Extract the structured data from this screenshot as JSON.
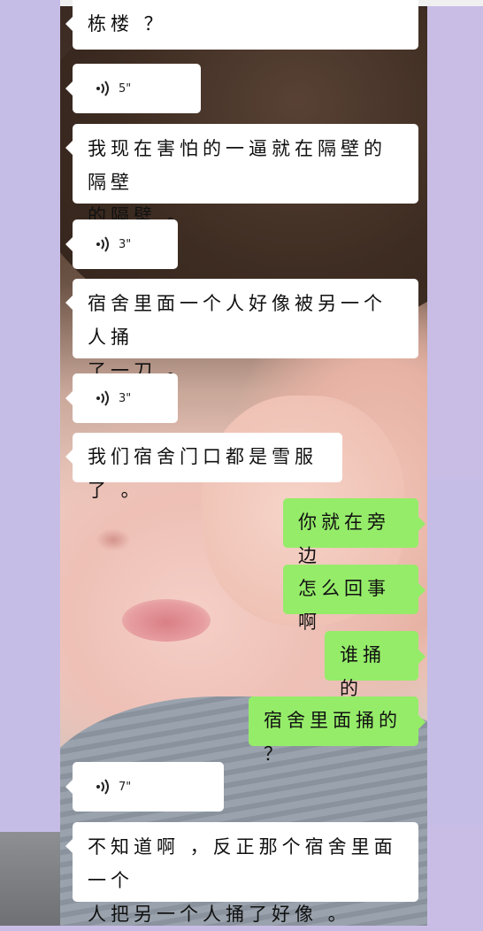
{
  "messages": [
    {
      "type": "text",
      "side": "left",
      "text": "栋楼？"
    },
    {
      "type": "voice",
      "side": "left",
      "duration": "5\""
    },
    {
      "type": "text",
      "side": "left",
      "text": "我现在害怕的一逼就在隔壁的隔壁的隔壁。"
    },
    {
      "type": "voice",
      "side": "left",
      "duration": "3\""
    },
    {
      "type": "text",
      "side": "left",
      "text": "宿舍里面一个人好像被另一个人捅了一刀。"
    },
    {
      "type": "voice",
      "side": "left",
      "duration": "3\""
    },
    {
      "type": "text",
      "side": "left",
      "text": "我们宿舍门口都是雪服了。"
    },
    {
      "type": "text",
      "side": "right",
      "text": "你就在旁边"
    },
    {
      "type": "text",
      "side": "right",
      "text": "怎么回事啊"
    },
    {
      "type": "text",
      "side": "right",
      "text": "谁捅的"
    },
    {
      "type": "text",
      "side": "right",
      "text": "宿舍里面捅的？"
    },
    {
      "type": "voice",
      "side": "left",
      "duration": "7\""
    },
    {
      "type": "text",
      "side": "left",
      "text": "不知道啊，反正那个宿舍里面一个人把另一个人捅了好像。"
    }
  ],
  "text": {
    "m0_l1": "栋楼 ？",
    "m2_l1": "我现在害怕的一逼就在隔壁的隔壁",
    "m2_l2": "的隔壁 。",
    "m4_l1": "宿舍里面一个人好像被另一个人捅",
    "m4_l2": "了一刀 。",
    "m6_l1": "我们宿舍门口都是雪服了 。",
    "m7": "你就在旁边",
    "m8": "怎么回事啊",
    "m9": "谁捅的",
    "m10": "宿舍里面捅的 ？",
    "m12_l1": "不知道啊 ，反正那个宿舍里面一个",
    "m12_l2": "人把另一个人捅了好像 。",
    "v1": "5\"",
    "v3": "3\"",
    "v5": "3\"",
    "v11": "7\""
  },
  "icons": {
    "voice": "voice-wave-icon"
  },
  "colors": {
    "sent_bubble": "#95ec69",
    "received_bubble": "#ffffff",
    "background": "#c6bde6"
  }
}
